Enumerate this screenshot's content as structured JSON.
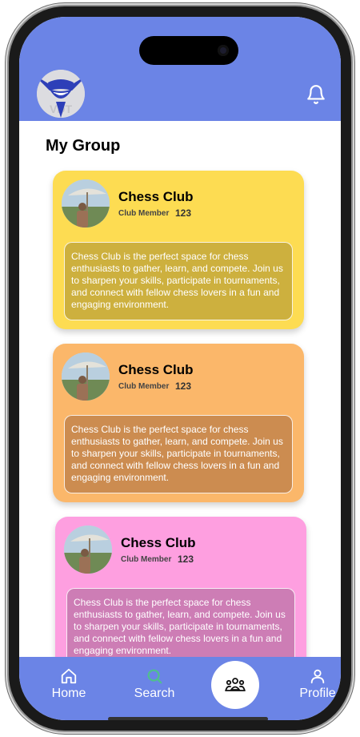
{
  "header": {
    "logo_icon": "ninja-mascot-logo",
    "bell_icon": "bell-icon",
    "bg_color": "#6b84e6"
  },
  "page": {
    "title": "My Group"
  },
  "cards": [
    {
      "name": "Chess Club",
      "member_label": "Club Member",
      "member_count": "123",
      "description": "Chess Club is the perfect space for chess enthusiasts to gather, learn, and compete. Join us to sharpen your skills, participate in tournaments, and connect with fellow chess lovers in a fun and engaging environment.",
      "bg_color": "#fddc52",
      "desc_color": "#cdb03e"
    },
    {
      "name": "Chess Club",
      "member_label": "Club Member",
      "member_count": "123",
      "description": "Chess Club is the perfect space for chess enthusiasts to gather, learn, and compete. Join us to sharpen your skills, participate in tournaments, and connect with fellow chess lovers in a fun and engaging environment.",
      "bg_color": "#fbb76a",
      "desc_color": "#cc8c50"
    },
    {
      "name": "Chess Club",
      "member_label": "Club Member",
      "member_count": "123",
      "description": "Chess Club is the perfect space for chess enthusiasts to gather, learn, and compete. Join us to sharpen your skills, participate in tournaments, and connect with fellow chess lovers in a fun and engaging environment.",
      "bg_color": "#fe9fe0",
      "desc_color": "#cd7db5"
    }
  ],
  "nav": {
    "home": "Home",
    "search": "Search",
    "groups_icon": "group-icon",
    "profile": "Profile"
  }
}
